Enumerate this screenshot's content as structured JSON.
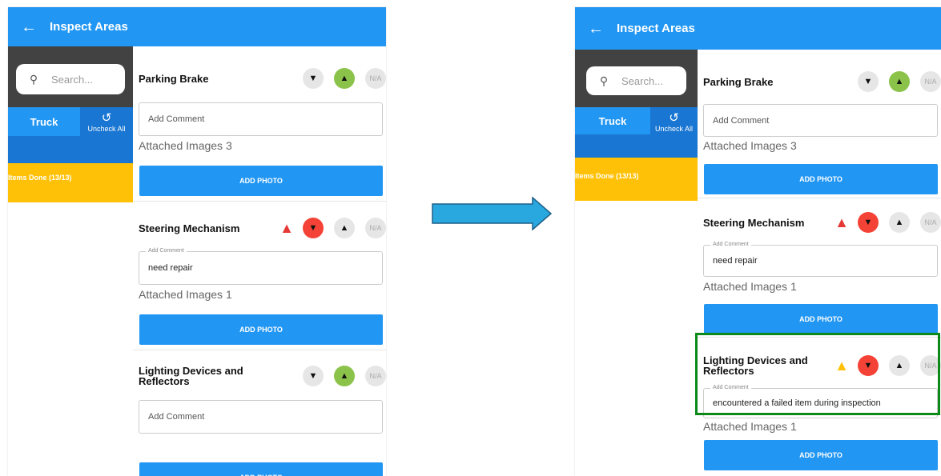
{
  "screens": [
    {
      "appbar": {
        "back_icon": "arrow-left-icon",
        "title": "Inspect Areas"
      },
      "sidebar": {
        "search_placeholder": "Search...",
        "tab_truck": "Truck",
        "uncheck_label": "Uncheck All",
        "items_done": "Items Done (13/13)"
      },
      "items": [
        {
          "name": "Parking Brake",
          "selected": "thumbs-up",
          "comment_placeholder": "Add Comment",
          "attached": "Attached Images 3",
          "add_photo": "ADD PHOTO"
        },
        {
          "name": "Steering Mechanism",
          "selected": "thumbs-down",
          "warning": "red",
          "comment_label": "Add Comment",
          "comment_value": "need repair",
          "attached": "Attached Images 1",
          "add_photo": "ADD PHOTO"
        },
        {
          "name": "Lighting Devices and Reflectors",
          "selected": "thumbs-up",
          "comment_placeholder": "Add Comment",
          "add_photo": "ADD PHOTO"
        }
      ],
      "na_label": "N/A"
    },
    {
      "appbar": {
        "back_icon": "arrow-left-icon",
        "title": "Inspect Areas"
      },
      "sidebar": {
        "search_placeholder": "Search...",
        "tab_truck": "Truck",
        "uncheck_label": "Uncheck All",
        "items_done": "Items Done (13/13)"
      },
      "items": [
        {
          "name": "Parking Brake",
          "selected": "thumbs-up",
          "comment_placeholder": "Add Comment",
          "attached": "Attached Images 3",
          "add_photo": "ADD PHOTO"
        },
        {
          "name": "Steering Mechanism",
          "selected": "thumbs-down",
          "warning": "red",
          "comment_label": "Add Comment",
          "comment_value": "need repair",
          "attached": "Attached Images 1",
          "add_photo": "ADD PHOTO"
        },
        {
          "name": "Lighting Devices and Reflectors",
          "selected": "thumbs-down",
          "warning": "amber",
          "comment_label": "Add Comment",
          "comment_value": "encountered a failed item during inspection",
          "attached": "Attached Images 1",
          "add_photo": "ADD PHOTO"
        }
      ],
      "na_label": "N/A"
    }
  ],
  "colors": {
    "primary": "#2196F3",
    "accent_yellow": "#FFC107",
    "thumbs_up": "#8BC34A",
    "thumbs_down": "#F44336",
    "highlight": "#0B8A1A"
  },
  "transition_icon": "arrow-right-icon"
}
